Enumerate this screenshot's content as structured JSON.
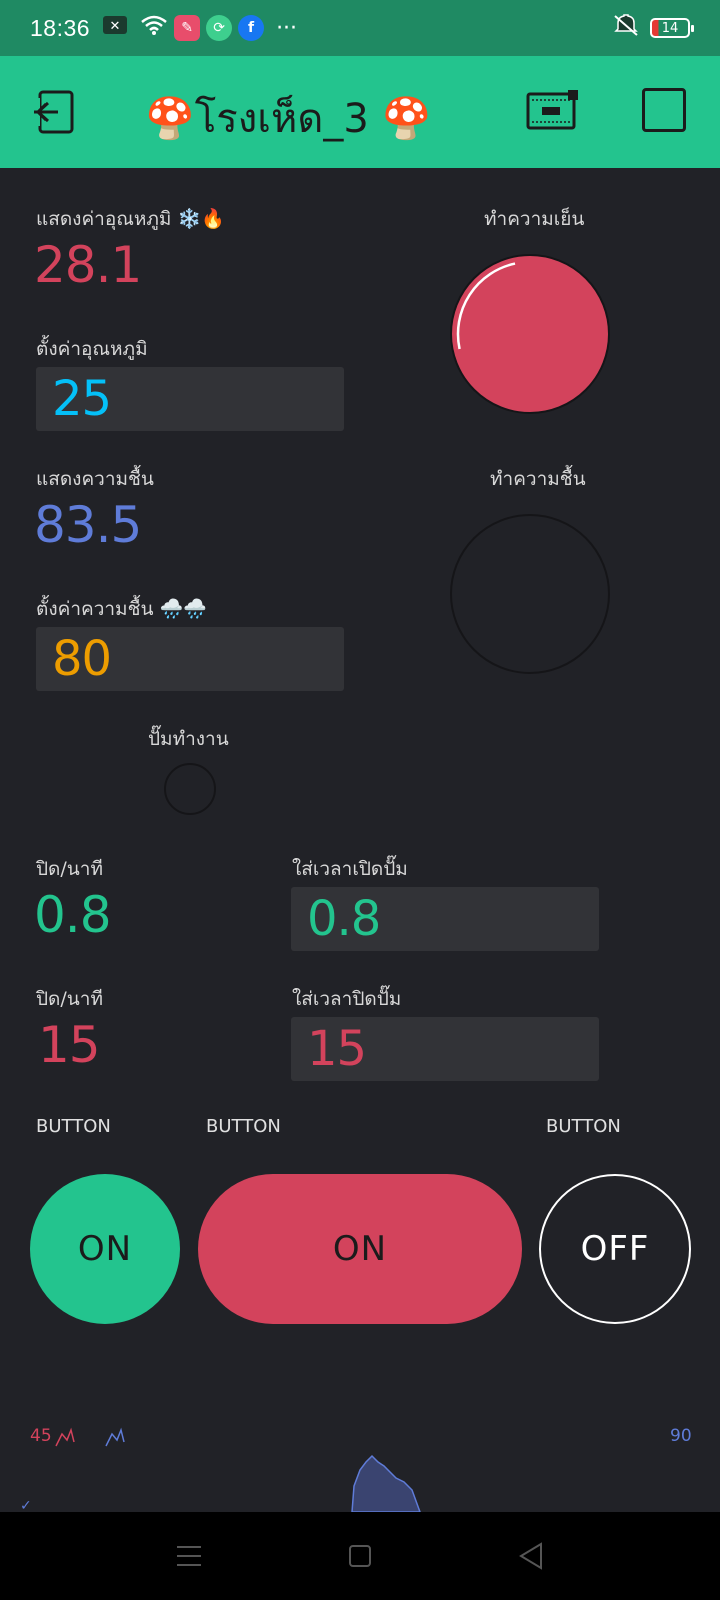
{
  "status_bar": {
    "time": "18:36",
    "more": "···",
    "battery_level": "14"
  },
  "header": {
    "title": "🍄โรงเห็ด_3 🍄"
  },
  "temperature": {
    "display_label": "แสดงค่าอุณหภูมิ ❄️🔥",
    "display_value": "28.1",
    "set_label": "ตั้งค่าอุณหภูมิ",
    "set_value": "25",
    "cooling_label": "ทำความเย็น"
  },
  "humidity": {
    "display_label": "แสดงความชื้น",
    "display_value": "83.5",
    "set_label": "ตั้งค่าความชื้น 🌧️🌧️",
    "set_value": "80",
    "humidify_label": "ทำความชื้น"
  },
  "pump": {
    "label": "ปั๊มทำงาน"
  },
  "timers": {
    "row1_label": "ปิด/นาที",
    "row1_value": "0.8",
    "row1_input_label": "ใส่เวลาเปิดปั๊ม",
    "row1_input_value": "0.8",
    "row2_label": "ปิด/นาที",
    "row2_value": "15",
    "row2_input_label": "ใส่เวลาปิดปั๊ม",
    "row2_input_value": "15"
  },
  "buttons": [
    {
      "label": "BUTTON",
      "state": "ON"
    },
    {
      "label": "BUTTON",
      "state": "ON"
    },
    {
      "label": "BUTTON",
      "state": "OFF"
    }
  ],
  "chart": {
    "left_axis_max": "45",
    "right_axis_max": "90"
  },
  "colors": {
    "header": "#23c48e",
    "status_bar": "#1f8a63",
    "red": "#d3435c",
    "green": "#23c48e",
    "blue": "#5f7cd8",
    "cyan": "#04c0f8",
    "orange": "#ed9d00",
    "background": "#212227"
  }
}
